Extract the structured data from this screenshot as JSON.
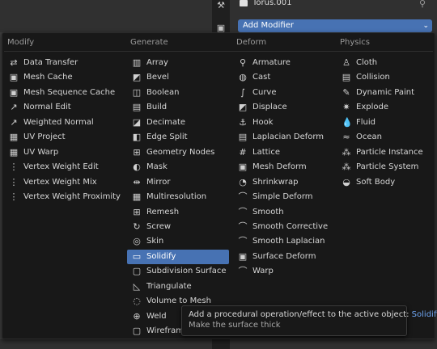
{
  "properties": {
    "object_name": "Torus.001",
    "add_modifier_label": "Add Modifier",
    "accent": "#4772b3"
  },
  "menu": {
    "columns": [
      {
        "header": "Modify",
        "items": [
          {
            "label": "Data Transfer",
            "icon": "data-transfer-icon"
          },
          {
            "label": "Mesh Cache",
            "icon": "mesh-cache-icon"
          },
          {
            "label": "Mesh Sequence Cache",
            "icon": "mesh-sequence-cache-icon"
          },
          {
            "label": "Normal Edit",
            "icon": "normal-edit-icon"
          },
          {
            "label": "Weighted Normal",
            "icon": "weighted-normal-icon"
          },
          {
            "label": "UV Project",
            "icon": "uv-project-icon"
          },
          {
            "label": "UV Warp",
            "icon": "uv-warp-icon"
          },
          {
            "label": "Vertex Weight Edit",
            "icon": "vertex-weight-edit-icon"
          },
          {
            "label": "Vertex Weight Mix",
            "icon": "vertex-weight-mix-icon"
          },
          {
            "label": "Vertex Weight Proximity",
            "icon": "vertex-weight-proximity-icon"
          }
        ]
      },
      {
        "header": "Generate",
        "items": [
          {
            "label": "Array",
            "icon": "array-icon"
          },
          {
            "label": "Bevel",
            "icon": "bevel-icon"
          },
          {
            "label": "Boolean",
            "icon": "boolean-icon"
          },
          {
            "label": "Build",
            "icon": "build-icon"
          },
          {
            "label": "Decimate",
            "icon": "decimate-icon"
          },
          {
            "label": "Edge Split",
            "icon": "edge-split-icon"
          },
          {
            "label": "Geometry Nodes",
            "icon": "geometry-nodes-icon"
          },
          {
            "label": "Mask",
            "icon": "mask-icon"
          },
          {
            "label": "Mirror",
            "icon": "mirror-icon"
          },
          {
            "label": "Multiresolution",
            "icon": "multiresolution-icon"
          },
          {
            "label": "Remesh",
            "icon": "remesh-icon"
          },
          {
            "label": "Screw",
            "icon": "screw-icon"
          },
          {
            "label": "Skin",
            "icon": "skin-icon"
          },
          {
            "label": "Solidify",
            "icon": "solidify-icon",
            "active": true
          },
          {
            "label": "Subdivision Surface",
            "icon": "subdivision-surface-icon"
          },
          {
            "label": "Triangulate",
            "icon": "triangulate-icon"
          },
          {
            "label": "Volume to Mesh",
            "icon": "volume-to-mesh-icon"
          },
          {
            "label": "Weld",
            "icon": "weld-icon"
          },
          {
            "label": "Wireframe",
            "icon": "wireframe-icon"
          }
        ]
      },
      {
        "header": "Deform",
        "items": [
          {
            "label": "Armature",
            "icon": "armature-icon"
          },
          {
            "label": "Cast",
            "icon": "cast-icon"
          },
          {
            "label": "Curve",
            "icon": "curve-icon"
          },
          {
            "label": "Displace",
            "icon": "displace-icon"
          },
          {
            "label": "Hook",
            "icon": "hook-icon"
          },
          {
            "label": "Laplacian Deform",
            "icon": "laplacian-deform-icon"
          },
          {
            "label": "Lattice",
            "icon": "lattice-icon"
          },
          {
            "label": "Mesh Deform",
            "icon": "mesh-deform-icon"
          },
          {
            "label": "Shrinkwrap",
            "icon": "shrinkwrap-icon"
          },
          {
            "label": "Simple Deform",
            "icon": "simple-deform-icon"
          },
          {
            "label": "Smooth",
            "icon": "smooth-icon"
          },
          {
            "label": "Smooth Corrective",
            "icon": "smooth-corrective-icon"
          },
          {
            "label": "Smooth Laplacian",
            "icon": "smooth-laplacian-icon"
          },
          {
            "label": "Surface Deform",
            "icon": "surface-deform-icon"
          },
          {
            "label": "Warp",
            "icon": "warp-icon"
          }
        ]
      },
      {
        "header": "Physics",
        "items": [
          {
            "label": "Cloth",
            "icon": "cloth-icon"
          },
          {
            "label": "Collision",
            "icon": "collision-icon"
          },
          {
            "label": "Dynamic Paint",
            "icon": "dynamic-paint-icon"
          },
          {
            "label": "Explode",
            "icon": "explode-icon"
          },
          {
            "label": "Fluid",
            "icon": "fluid-icon"
          },
          {
            "label": "Ocean",
            "icon": "ocean-icon"
          },
          {
            "label": "Particle Instance",
            "icon": "particle-instance-icon"
          },
          {
            "label": "Particle System",
            "icon": "particle-system-icon"
          },
          {
            "label": "Soft Body",
            "icon": "soft-body-icon"
          }
        ]
      }
    ]
  },
  "tooltip": {
    "text": "Add a procedural operation/effect to the active object:",
    "highlight": "Solidify",
    "subtext": "Make the surface thick"
  }
}
